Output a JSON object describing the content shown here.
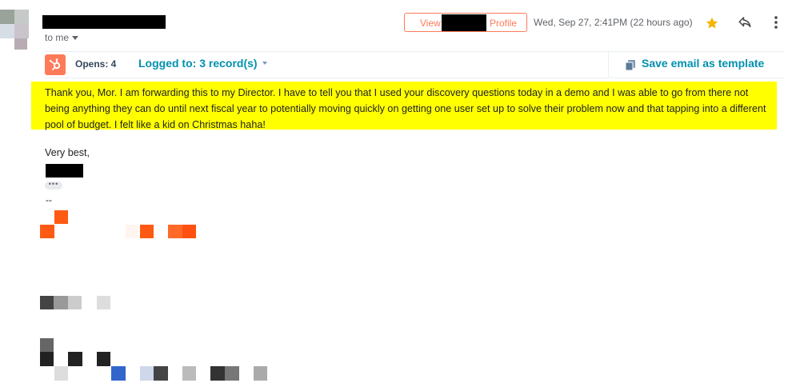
{
  "header": {
    "recipient_label": "to me",
    "view_profile_prefix": "View",
    "view_profile_suffix": "Profile",
    "date": "Wed, Sep 27, 2:41PM (22 hours ago)",
    "icons": {
      "star": "star-icon",
      "reply": "reply-icon",
      "more": "more-vert-icon",
      "caret": "chevron-down-icon"
    },
    "colors": {
      "star": "#f4b400",
      "accent": "#ff7a59"
    }
  },
  "hubspot_bar": {
    "opens_label": "Opens: 4",
    "logged_label": "Logged to: 3 record(s)",
    "save_template_label": "Save email as template",
    "icons": {
      "logo": "hubspot-logo-icon",
      "template": "copy-icon"
    },
    "colors": {
      "link": "#0091ae",
      "logo_bg": "#ff7a59"
    }
  },
  "body": {
    "highlighted_text": "Thank you, Mor. I am forwarding this to my Director. I have to tell you that I used your discovery questions today in a demo and I was able to go from there not being anything they can do until next fiscal year to potentially moving quickly on getting one user set up to solve their problem now and that tapping into a different pool of budget. I felt like a kid on Christmas haha!",
    "highlight_color": "#ffff00",
    "signoff": "Very best,",
    "trimmed_button": "•••",
    "signature_separator": "--"
  }
}
